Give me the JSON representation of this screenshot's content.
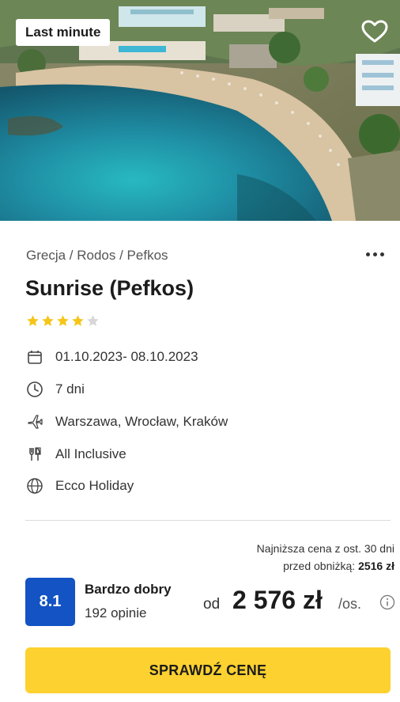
{
  "hero": {
    "badge": "Last minute",
    "image_icon": "beach-resort-photo",
    "favorite_icon": "heart-icon"
  },
  "offer": {
    "breadcrumb": "Grecja / Rodos / Pefkos",
    "title": "Sunrise (Pefkos)",
    "stars_rating": 4,
    "stars_max": 5,
    "details": {
      "dates": "01.10.2023- 08.10.2023",
      "duration": "7 dni",
      "departure": "Warszawa, Wrocław, Kraków",
      "board": "All Inclusive",
      "operator": "Ecco Holiday"
    },
    "icons": {
      "dates": "calendar-icon",
      "duration": "clock-icon",
      "departure": "plane-icon",
      "board": "cutlery-icon",
      "operator": "globe-icon"
    }
  },
  "pricing": {
    "lowest_line1": "Najniższa cena z ost. 30 dni",
    "lowest_line2_prefix": "przed obniżką: ",
    "lowest_line2_value": "2516 zł",
    "prefix": "od",
    "price": "2 576 zł",
    "per": "/os."
  },
  "rating": {
    "score": "8.1",
    "label": "Bardzo dobry",
    "count": "192 opinie"
  },
  "cta": {
    "label": "SPRAWDŹ CENĘ"
  },
  "colors": {
    "accent_yellow": "#fdd12f",
    "rating_blue": "#1353c4",
    "star_gold": "#f5c518",
    "star_empty": "#d7d7d7"
  }
}
